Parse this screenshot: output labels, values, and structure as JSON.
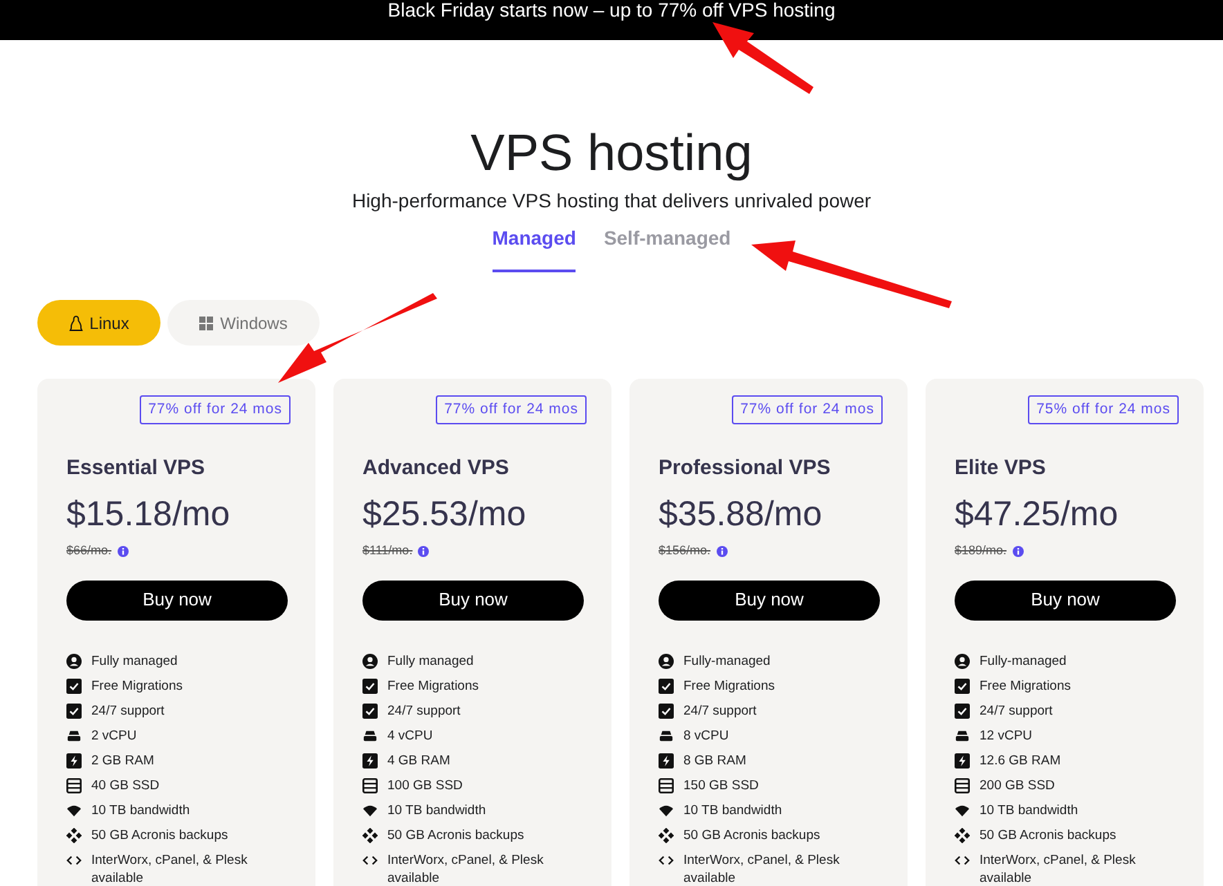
{
  "banner": {
    "text": "Black Friday starts now – up to 77% off VPS hosting"
  },
  "heading": {
    "title": "VPS hosting",
    "subtitle": "High-performance VPS hosting that delivers unrivaled power"
  },
  "tabs": [
    {
      "label": "Managed",
      "selected": true
    },
    {
      "label": "Self-managed",
      "selected": false
    }
  ],
  "os_toggle": [
    {
      "label": "Linux",
      "kind": "linux",
      "selected": true
    },
    {
      "label": "Windows",
      "kind": "windows",
      "selected": false
    }
  ],
  "plans": [
    {
      "badge": "77% off for 24 mos",
      "name": "Essential VPS",
      "price": "$15.18/mo",
      "old_price": "$66/mo.",
      "button": "Buy now",
      "features": [
        {
          "kind": "person",
          "text": "Fully managed"
        },
        {
          "kind": "check",
          "text": "Free Migrations"
        },
        {
          "kind": "check",
          "text": "24/7 support"
        },
        {
          "kind": "cpu",
          "text": "2 vCPU"
        },
        {
          "kind": "ram",
          "text": "2 GB RAM"
        },
        {
          "kind": "ssd",
          "text": "40 GB SSD"
        },
        {
          "kind": "bandwidth",
          "text": "10 TB bandwidth"
        },
        {
          "kind": "backup",
          "text": "50 GB Acronis backups"
        },
        {
          "kind": "code",
          "text": "InterWorx, cPanel, & Plesk available"
        }
      ]
    },
    {
      "badge": "77% off for 24 mos",
      "name": "Advanced VPS",
      "price": "$25.53/mo",
      "old_price": "$111/mo.",
      "button": "Buy now",
      "features": [
        {
          "kind": "person",
          "text": "Fully managed"
        },
        {
          "kind": "check",
          "text": "Free Migrations"
        },
        {
          "kind": "check",
          "text": "24/7 support"
        },
        {
          "kind": "cpu",
          "text": "4 vCPU"
        },
        {
          "kind": "ram",
          "text": "4 GB RAM"
        },
        {
          "kind": "ssd",
          "text": "100 GB SSD"
        },
        {
          "kind": "bandwidth",
          "text": "10 TB bandwidth"
        },
        {
          "kind": "backup",
          "text": "50 GB Acronis backups"
        },
        {
          "kind": "code",
          "text": "InterWorx, cPanel, & Plesk available"
        }
      ]
    },
    {
      "badge": "77% off for 24 mos",
      "name": "Professional VPS",
      "price": "$35.88/mo",
      "old_price": "$156/mo.",
      "button": "Buy now",
      "features": [
        {
          "kind": "person",
          "text": "Fully-managed"
        },
        {
          "kind": "check",
          "text": "Free Migrations"
        },
        {
          "kind": "check",
          "text": "24/7 support"
        },
        {
          "kind": "cpu",
          "text": "8 vCPU"
        },
        {
          "kind": "ram",
          "text": "8 GB RAM"
        },
        {
          "kind": "ssd",
          "text": "150 GB SSD"
        },
        {
          "kind": "bandwidth",
          "text": "10 TB bandwidth"
        },
        {
          "kind": "backup",
          "text": "50 GB Acronis backups"
        },
        {
          "kind": "code",
          "text": "InterWorx, cPanel, & Plesk available"
        }
      ]
    },
    {
      "badge": "75% off for 24 mos",
      "name": "Elite VPS",
      "price": "$47.25/mo",
      "old_price": "$189/mo.",
      "button": "Buy now",
      "features": [
        {
          "kind": "person",
          "text": "Fully-managed"
        },
        {
          "kind": "check",
          "text": "Free Migrations"
        },
        {
          "kind": "check",
          "text": "24/7 support"
        },
        {
          "kind": "cpu",
          "text": "12 vCPU"
        },
        {
          "kind": "ram",
          "text": "12.6 GB RAM"
        },
        {
          "kind": "ssd",
          "text": "200 GB SSD"
        },
        {
          "kind": "bandwidth",
          "text": "10 TB bandwidth"
        },
        {
          "kind": "backup",
          "text": "50 GB Acronis backups"
        },
        {
          "kind": "code",
          "text": "InterWorx, cPanel, & Plesk available"
        }
      ]
    }
  ]
}
